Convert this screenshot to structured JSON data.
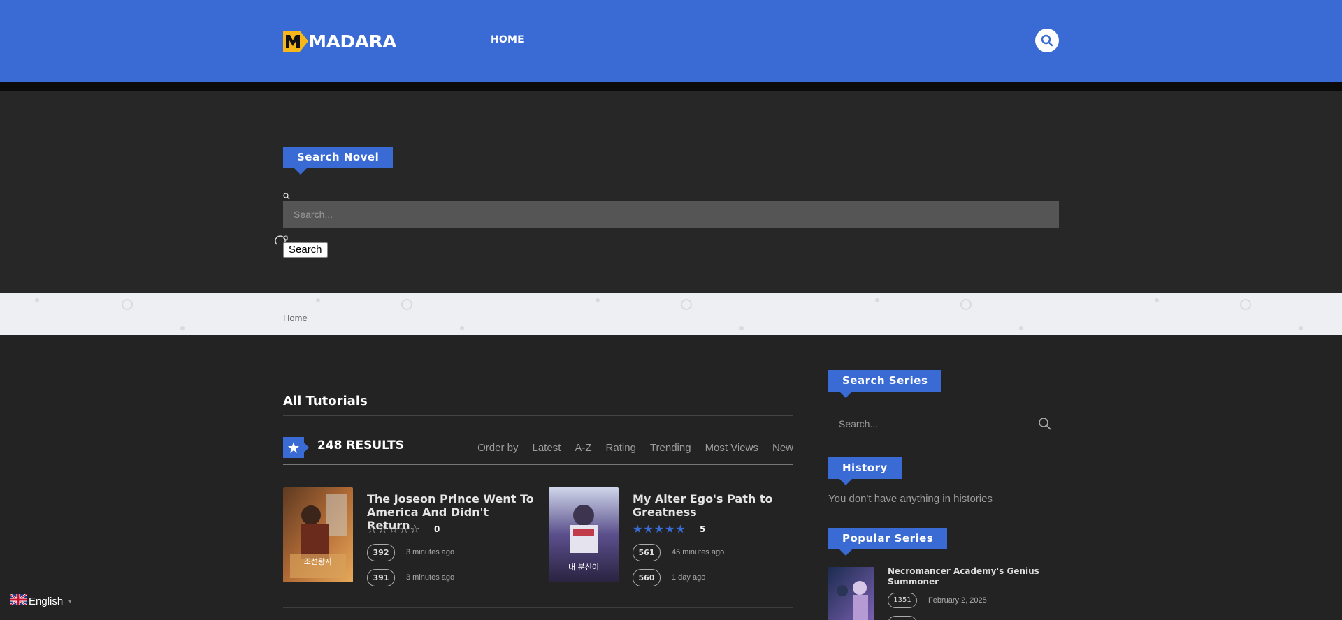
{
  "header": {
    "logo_text": "MADARA",
    "nav_home": "HOME"
  },
  "hero": {
    "heading": "Search Novel",
    "search_placeholder": "Search...",
    "search_button": "Search"
  },
  "breadcrumb": {
    "home": "Home"
  },
  "main": {
    "title": "All Tutorials",
    "results": "248 RESULTS",
    "order_by": {
      "label": "Order by",
      "options": [
        "Latest",
        "A-Z",
        "Rating",
        "Trending",
        "Most Views",
        "New"
      ]
    },
    "items": [
      {
        "title": "The Joseon Prince Went To America And Didn't Return",
        "rating": "0",
        "chapters": [
          {
            "num": "392",
            "time": "3 minutes ago"
          },
          {
            "num": "391",
            "time": "3 minutes ago"
          }
        ]
      },
      {
        "title": "My Alter Ego's Path to Greatness",
        "rating": "5",
        "chapters": [
          {
            "num": "561",
            "time": "45 minutes ago"
          },
          {
            "num": "560",
            "time": "1 day ago"
          }
        ]
      }
    ]
  },
  "sidebar": {
    "search_heading": "Search Series",
    "search_placeholder": "Search...",
    "history_heading": "History",
    "history_empty": "You don't have anything in histories",
    "popular_heading": "Popular Series",
    "popular": [
      {
        "title": "Necromancer Academy's Genius Summoner",
        "chapter": "1351",
        "date": "February 2, 2025"
      }
    ]
  },
  "language": {
    "current": "English"
  },
  "colors": {
    "brand_blue": "#3a6bd5",
    "background": "#232323",
    "breadcrumb_band": "#eeeff2"
  }
}
